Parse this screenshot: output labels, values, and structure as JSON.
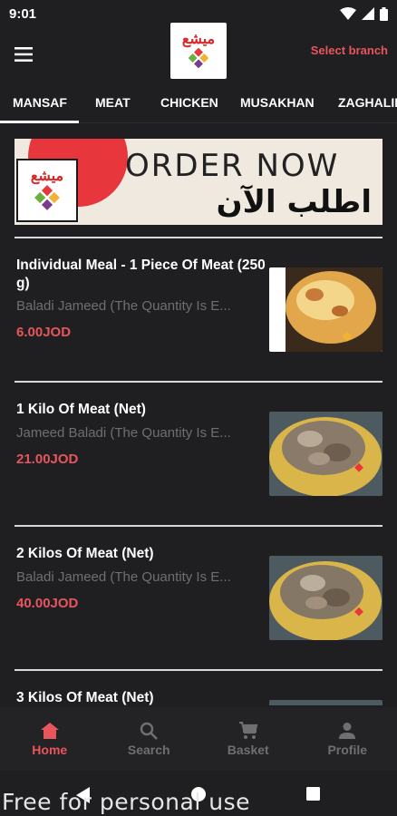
{
  "status_bar": {
    "time": "9:01"
  },
  "app_bar": {
    "logo_text": "ميشع",
    "select_branch_label": "Select branch"
  },
  "tabs": [
    {
      "label": "MANSAF"
    },
    {
      "label": "MEAT"
    },
    {
      "label": "CHICKEN"
    },
    {
      "label": "MUSAKHAN"
    },
    {
      "label": "ZAGHALIL"
    }
  ],
  "banner": {
    "logo_text": "ميشع",
    "title_en": "ORDER NOW",
    "title_ar": "اطلب الآن"
  },
  "items": [
    {
      "name": "Individual Meal - 1 Piece Of Meat (250 g)",
      "description": "Baladi Jameed (The Quantity Is E...",
      "price": "6.00JOD"
    },
    {
      "name": "1 Kilo Of Meat (Net)",
      "description": "Jameed Baladi (The Quantity Is E...",
      "price": "21.00JOD"
    },
    {
      "name": "2 Kilos Of Meat (Net)",
      "description": "Baladi Jameed (The Quantity Is E...",
      "price": "40.00JOD"
    },
    {
      "name": "3 Kilos Of Meat (Net)",
      "description": "",
      "price": ""
    }
  ],
  "bottom_nav": [
    {
      "label": "Home",
      "icon": "home-icon",
      "active": true
    },
    {
      "label": "Search",
      "icon": "search-icon",
      "active": false
    },
    {
      "label": "Basket",
      "icon": "cart-icon",
      "active": false
    },
    {
      "label": "Profile",
      "icon": "person-icon",
      "active": false
    }
  ],
  "watermark": "Free for personal use",
  "colors": {
    "accent": "#e8555d",
    "background": "#1f1f21",
    "nav_background": "#232325",
    "muted_text": "#6f6f73"
  }
}
